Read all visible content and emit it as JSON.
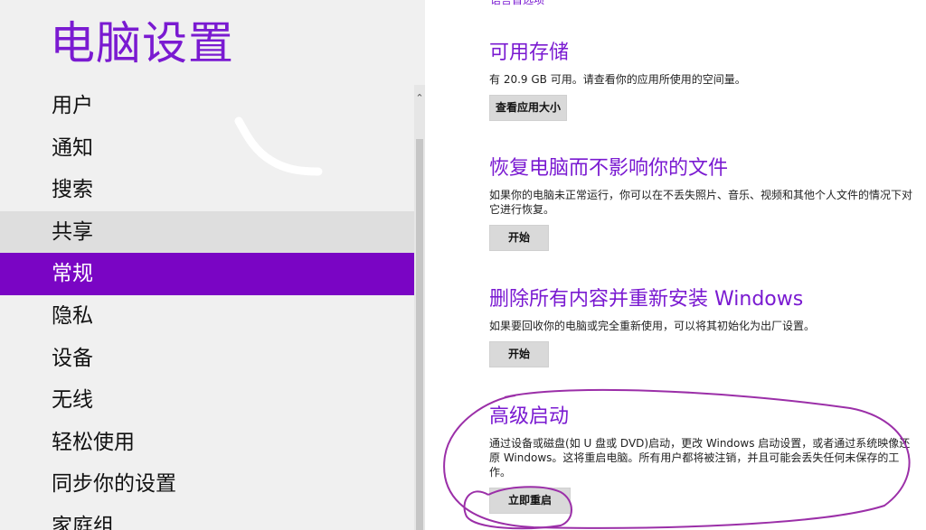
{
  "left": {
    "title": "电脑设置",
    "nav_items": [
      {
        "label": "用户"
      },
      {
        "label": "通知"
      },
      {
        "label": "搜索"
      },
      {
        "label": "共享"
      },
      {
        "label": "常规"
      },
      {
        "label": "隐私"
      },
      {
        "label": "设备"
      },
      {
        "label": "无线"
      },
      {
        "label": "轻松使用"
      },
      {
        "label": "同步你的设置"
      },
      {
        "label": "家庭组"
      }
    ],
    "hover_index": 3,
    "selected_index": 4
  },
  "right": {
    "top_link": "语言首选项",
    "storage": {
      "title": "可用存储",
      "desc": "有 20.9 GB 可用。请查看你的应用所使用的空间量。",
      "button": "查看应用大小"
    },
    "refresh": {
      "title": "恢复电脑而不影响你的文件",
      "desc": "如果你的电脑未正常运行，你可以在不丢失照片、音乐、视频和其他个人文件的情况下对它进行恢复。",
      "button": "开始"
    },
    "reset": {
      "title": "删除所有内容并重新安装 Windows",
      "desc": "如果要回收你的电脑或完全重新使用，可以将其初始化为出厂设置。",
      "button": "开始"
    },
    "advanced": {
      "title": "高级启动",
      "desc": "通过设备或磁盘(如 U 盘或 DVD)启动，更改 Windows 启动设置，或者通过系统映像还原 Windows。这将重启电脑。所有用户都将被注销，并且可能会丢失任何未保存的工作。",
      "button": "立即重启"
    }
  },
  "colors": {
    "accent": "#7a1ad1",
    "selected_bg": "#7a05c4",
    "annotation": "#9b2fa8"
  }
}
